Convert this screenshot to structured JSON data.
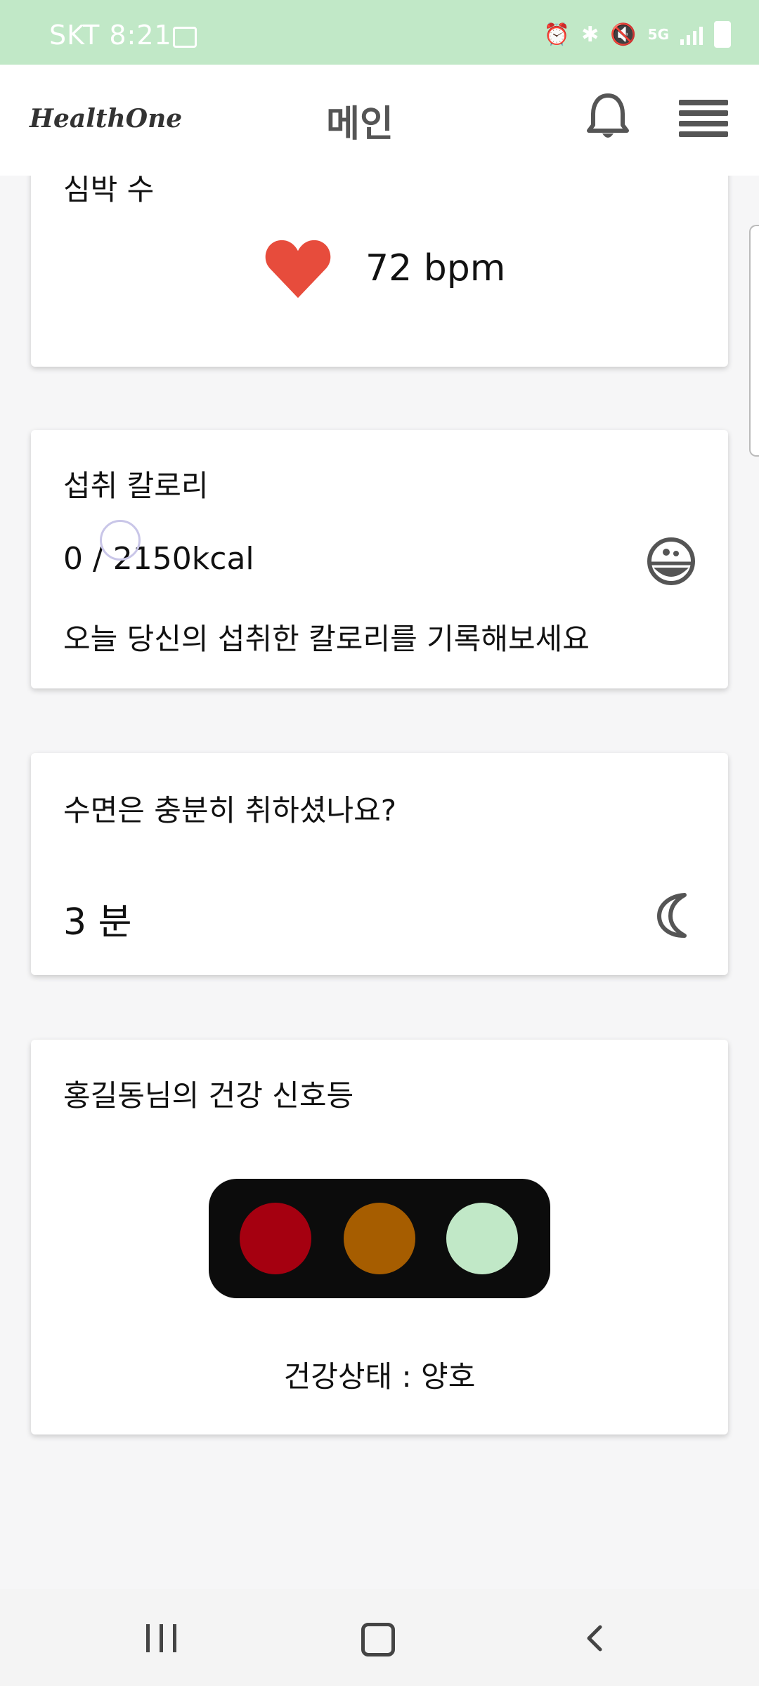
{
  "status_bar": {
    "carrier_time": "SKT 8:21",
    "network": "5G"
  },
  "app_bar": {
    "logo": "HealthOne",
    "title": "메인"
  },
  "heart_card": {
    "title": "심박 수",
    "value": "72 bpm"
  },
  "calorie_card": {
    "title": "섭취 칼로리",
    "value": "0 / 2150kcal",
    "message": "오늘 당신의 섭취한 칼로리를 기록해보세요"
  },
  "sleep_card": {
    "title": "수면은 충분히 취하셨나요?",
    "value": "3 분"
  },
  "health_card": {
    "title": "홍길동님의 건강 신호등",
    "status": "건강상태 : 양호"
  },
  "colors": {
    "accent": "#c1e8c7",
    "heart": "#e74c3c",
    "light_red": "#a50010",
    "light_orange": "#a65d00",
    "light_green": "#c1e8c7",
    "light_housing": "#0c0c0c"
  }
}
